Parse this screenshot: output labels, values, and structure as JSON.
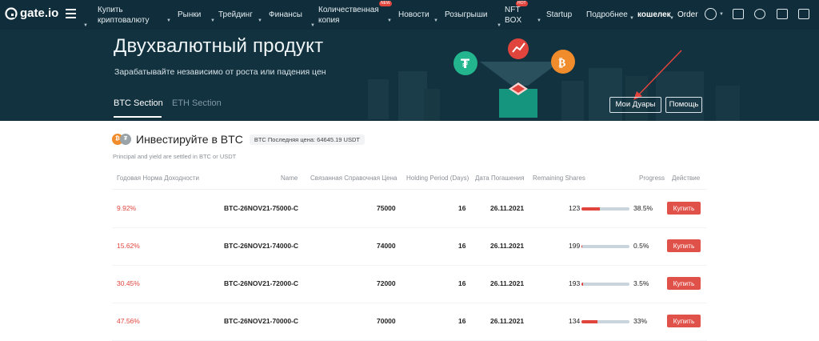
{
  "brand": {
    "name": "gate.io"
  },
  "nav": {
    "items": [
      {
        "label_line1": "Купить",
        "label_line2": "криптовалюту"
      },
      {
        "label": "Рынки"
      },
      {
        "label": "Трейдинг"
      },
      {
        "label": "Финансы"
      },
      {
        "label_line1": "Количественная",
        "label_line2": "копия",
        "badge": "NEW"
      },
      {
        "label": "Новости"
      },
      {
        "label": "Розыгрыши"
      },
      {
        "label_line1": "NFT",
        "label_line2": "BOX",
        "badge": "HOT"
      },
      {
        "label": "Startup"
      },
      {
        "label": "Подробнее"
      }
    ],
    "wallet": "кошелек",
    "order": "Order"
  },
  "hero": {
    "title": "Двухвалютный продукт",
    "subtitle": "Зарабатывайте независимо от роста или падения цен",
    "tabs": [
      "BTC Section",
      "ETH Section"
    ],
    "buttons": {
      "my_duals": "Мои Дуары",
      "help": "Помощь"
    }
  },
  "section": {
    "title": "Инвестируйте в BTC",
    "last_price": "BTC Последняя цена: 64645.19 USDT",
    "settled_note": "Principal and yield are settled in BTC or USDT",
    "columns": [
      "Годовая Норма Доходности",
      "Name",
      "Связанная Справочная Цена",
      "Holding Period (Days)",
      "Дата Погашения",
      "Remaining Shares",
      "Progress",
      "Действие"
    ],
    "rows": [
      {
        "rate": "9.92%",
        "name": "BTC-26NOV21-75000-C",
        "ref_price": "75000",
        "days": "16",
        "date": "26.11.2021",
        "shares": "123",
        "progress_pct": 38.5,
        "progress": "38.5%",
        "action": "Купить"
      },
      {
        "rate": "15.62%",
        "name": "BTC-26NOV21-74000-C",
        "ref_price": "74000",
        "days": "16",
        "date": "26.11.2021",
        "shares": "199",
        "progress_pct": 0.5,
        "progress": "0.5%",
        "action": "Купить"
      },
      {
        "rate": "30.45%",
        "name": "BTC-26NOV21-72000-C",
        "ref_price": "72000",
        "days": "16",
        "date": "26.11.2021",
        "shares": "193",
        "progress_pct": 3.5,
        "progress": "3.5%",
        "action": "Купить"
      },
      {
        "rate": "47.56%",
        "name": "BTC-26NOV21-70000-C",
        "ref_price": "70000",
        "days": "16",
        "date": "26.11.2021",
        "shares": "134",
        "progress_pct": 33,
        "progress": "33%",
        "action": "Купить"
      }
    ]
  },
  "colors": {
    "nav_bg": "#0f2d3a",
    "hero_bg": "#12323f",
    "accent_red": "#e0443c"
  }
}
